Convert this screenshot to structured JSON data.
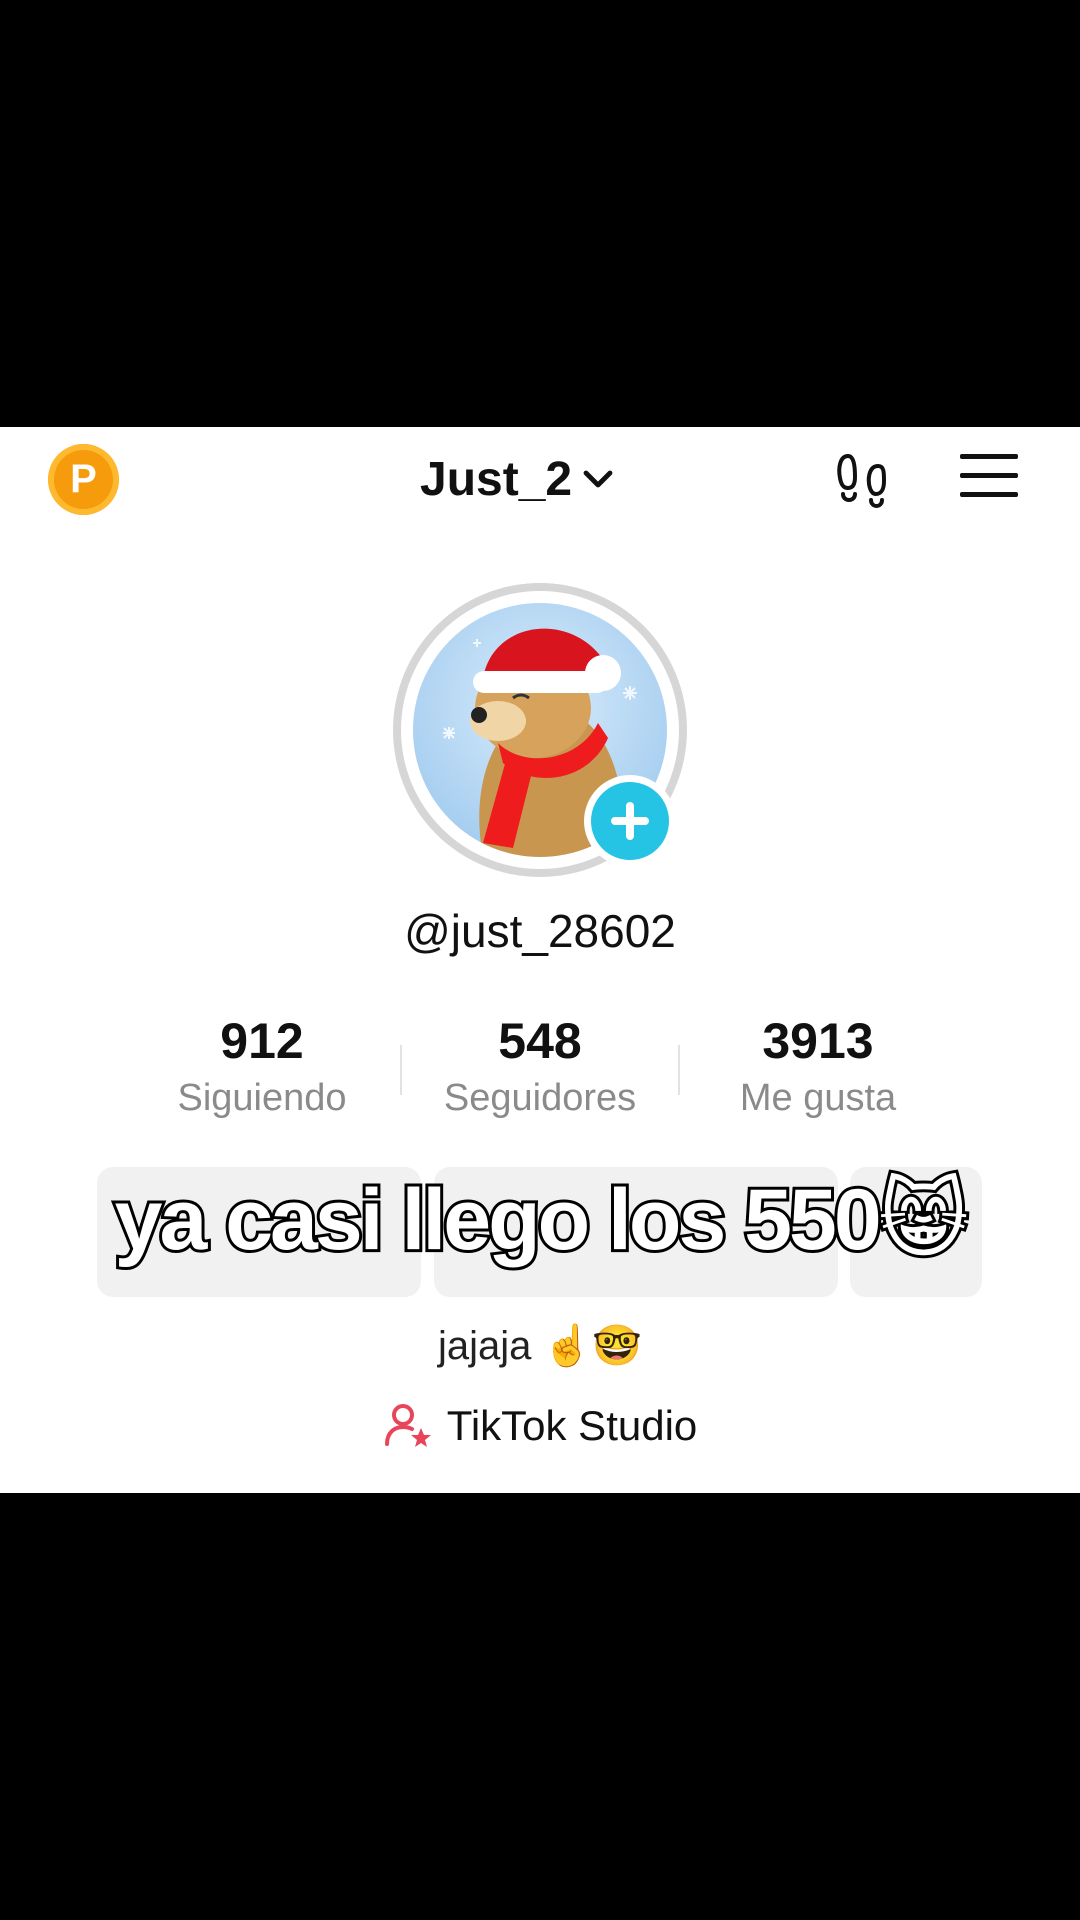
{
  "header": {
    "points_badge": "P",
    "username": "Just_2",
    "icons": [
      "points-badge-icon",
      "footprints-icon",
      "menu-icon"
    ]
  },
  "profile": {
    "handle": "@just_28602",
    "avatar_desc_icon": "avatar-dog-santa-hat"
  },
  "stats": [
    {
      "value": "912",
      "label": "Siguiendo"
    },
    {
      "value": "548",
      "label": "Seguidores"
    },
    {
      "value": "3913",
      "label": "Me gusta"
    }
  ],
  "overlay_caption": "ya casi llego los 550😸",
  "bio": "jajaja ☝️🤓",
  "studio_link": "TikTok Studio",
  "colors": {
    "points_badge": "#f59b0c",
    "add_button": "#25c3e4",
    "studio_icon": "#e8445a"
  }
}
